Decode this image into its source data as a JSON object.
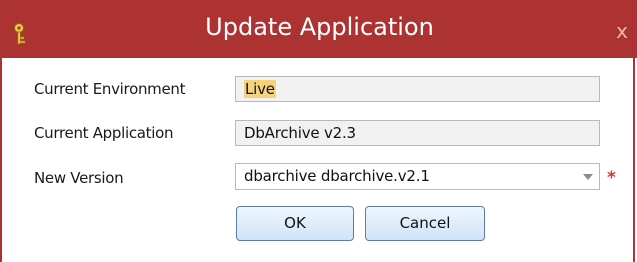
{
  "window": {
    "title": "Update Application",
    "title_icon": "key-icon",
    "close_label": "x",
    "titlebar_color": "#ad3333"
  },
  "form": {
    "environment": {
      "label": "Current Environment",
      "value": "Live"
    },
    "application": {
      "label": "Current Application",
      "value": "DbArchive v2.3"
    },
    "version": {
      "label": "New Version",
      "value": "dbarchive dbarchive.v2.1",
      "required_mark": "*"
    }
  },
  "buttons": {
    "ok": "OK",
    "cancel": "Cancel"
  }
}
